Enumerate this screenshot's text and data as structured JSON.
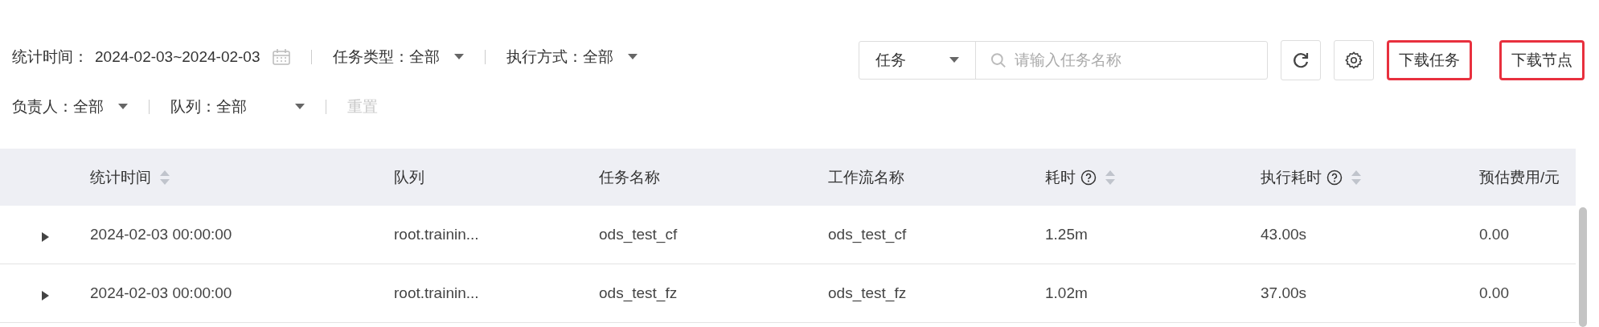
{
  "filters_row_1": [
    {
      "kind": "date",
      "label": "统计时间：",
      "value": "2024-02-03~2024-02-03"
    },
    {
      "kind": "select",
      "label": "任务类型：",
      "value": "全部"
    },
    {
      "kind": "select",
      "label": "执行方式：",
      "value": "全部"
    }
  ],
  "filters_row_2": [
    {
      "kind": "select",
      "label": "负责人：",
      "value": "全部"
    },
    {
      "kind": "select",
      "label": "队列：",
      "value": "全部"
    },
    {
      "kind": "reset",
      "label": "重置",
      "disabled": true
    }
  ],
  "search": {
    "scope": "任务",
    "placeholder": "请输入任务名称"
  },
  "download_buttons": [
    {
      "label": "下载任务",
      "highlighted": true
    },
    {
      "label": "下载节点",
      "highlighted": true
    }
  ],
  "table": {
    "columns": [
      {
        "label": "统计时间",
        "sortable": true,
        "help": false
      },
      {
        "label": "队列",
        "sortable": false,
        "help": false
      },
      {
        "label": "任务名称",
        "sortable": false,
        "help": false
      },
      {
        "label": "工作流名称",
        "sortable": false,
        "help": false
      },
      {
        "label": "耗时",
        "sortable": true,
        "help": true
      },
      {
        "label": "执行耗时",
        "sortable": true,
        "help": true
      },
      {
        "label": "预估费用/元",
        "sortable": false,
        "help": false
      }
    ],
    "rows": [
      {
        "expanded": false,
        "cells": [
          "2024-02-03 00:00:00",
          "root.trainin...",
          "ods_test_cf",
          "ods_test_cf",
          "1.25m",
          "43.00s",
          "0.00"
        ]
      },
      {
        "expanded": false,
        "cells": [
          "2024-02-03 00:00:00",
          "root.trainin...",
          "ods_test_fz",
          "ods_test_fz",
          "1.02m",
          "37.00s",
          "0.00"
        ]
      }
    ]
  }
}
